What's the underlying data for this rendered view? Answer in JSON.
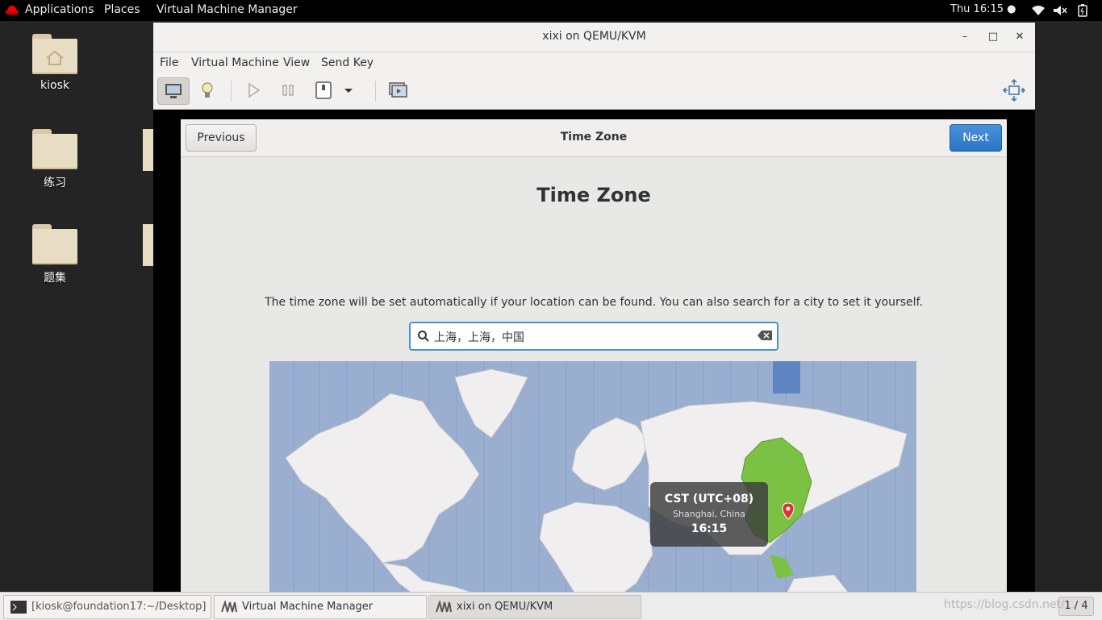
{
  "topbar": {
    "applications": "Applications",
    "places": "Places",
    "app_name": "Virtual Machine Manager",
    "clock": "Thu 16:15 ●"
  },
  "desktop": {
    "icons": [
      {
        "label": "kiosk"
      },
      {
        "label": "练习"
      },
      {
        "label": "题集"
      }
    ]
  },
  "window": {
    "title": "xixi on QEMU/KVM",
    "menu": [
      "File",
      "Virtual Machine",
      "View",
      "Send Key"
    ]
  },
  "installer": {
    "previous": "Previous",
    "next": "Next",
    "header_title": "Time Zone",
    "page_title": "Time Zone",
    "description": "The time zone will be set automatically if your location can be found. You can also search for a city to set it yourself.",
    "search_value": "上海，上海，中国",
    "tooltip": {
      "zone": "CST (UTC+08)",
      "city": "Shanghai, China",
      "time": "16:15"
    }
  },
  "taskbar": {
    "tasks": [
      {
        "label": "[kiosk@foundation17:~/Desktop]"
      },
      {
        "label": "Virtual Machine Manager"
      },
      {
        "label": "xixi on QEMU/KVM"
      }
    ],
    "pager": "1 / 4",
    "watermark": "https://blog.csdn.net/..."
  },
  "colors": {
    "accent": "#4a90d9",
    "map_ocean": "#9aaed0",
    "map_land": "#f0eeee",
    "selected_zone": "#7bc143"
  }
}
